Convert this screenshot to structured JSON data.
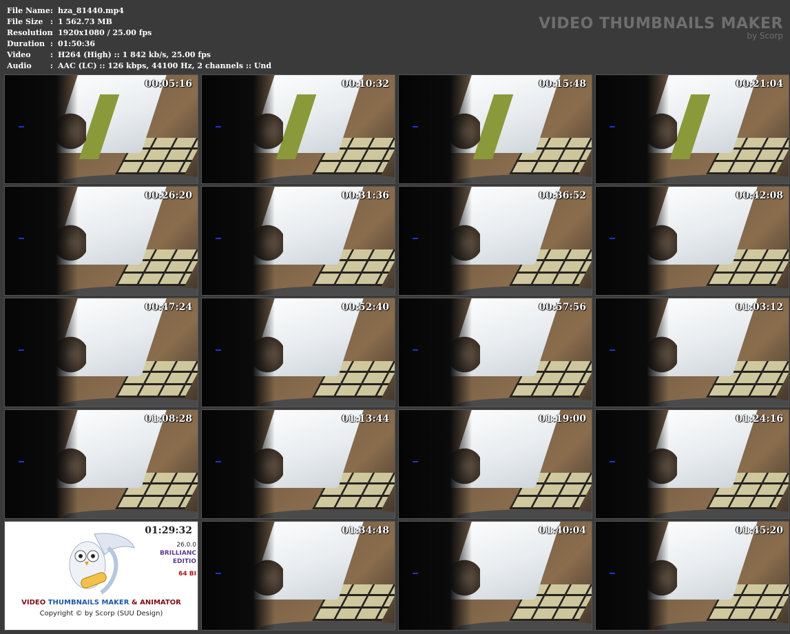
{
  "file_info": [
    {
      "key": "File Name",
      "value": "hza_81440.mp4"
    },
    {
      "key": "File Size",
      "value": "1 562.73 MB"
    },
    {
      "key": "Resolution",
      "value": "1920x1080 / 25.00 fps"
    },
    {
      "key": "Duration",
      "value": "01:50:36"
    },
    {
      "key": "Video",
      "value": "H264 (High) :: 1 842 kb/s, 25.00 fps"
    },
    {
      "key": "Audio",
      "value": "AAC (LC) :: 126 kbps, 44100 Hz, 2 channels :: Und"
    }
  ],
  "separator": ":",
  "brand": {
    "title": "VIDEO THUMBNAILS MAKER",
    "subtitle": "by Scorp"
  },
  "thumbnails": [
    {
      "time": "00:05:16"
    },
    {
      "time": "00:10:32"
    },
    {
      "time": "00:15:48"
    },
    {
      "time": "00:21:04"
    },
    {
      "time": "00:26:20"
    },
    {
      "time": "00:31:36"
    },
    {
      "time": "00:36:52"
    },
    {
      "time": "00:42:08"
    },
    {
      "time": "00:47:24"
    },
    {
      "time": "00:52:40"
    },
    {
      "time": "00:57:56"
    },
    {
      "time": "01:03:12"
    },
    {
      "time": "01:08:28"
    },
    {
      "time": "01:13:44"
    },
    {
      "time": "01:19:00"
    },
    {
      "time": "01:24:16"
    },
    {
      "time": "01:29:32"
    },
    {
      "time": "01:34:48"
    },
    {
      "time": "01:40:04"
    },
    {
      "time": "01:45:20"
    }
  ],
  "promo": {
    "line1_a": "VIDEO ",
    "line1_b": "THUMBNAILS MAKER",
    "line1_c": " & ANIMATOR",
    "copyright": "Copyright © by Scorp (SUU Design)",
    "edition_l1": "26.0.0",
    "edition_l2": "BRILLIANC",
    "edition_l3": "EDITIO",
    "edition_l4": "64 BI"
  }
}
